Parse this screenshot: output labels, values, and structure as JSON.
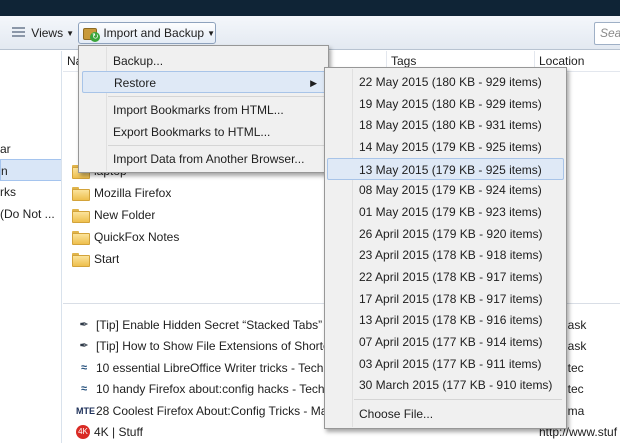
{
  "toolbar": {
    "views_label": "Views",
    "import_backup_label": "Import and Backup",
    "search_placeholder": "Sea"
  },
  "sidebar": {
    "items": [
      {
        "label": "ar"
      },
      {
        "label": "n"
      },
      {
        "label": "rks"
      },
      {
        "label": "(Do Not ..."
      }
    ]
  },
  "columns": {
    "name": "Na",
    "tags": "Tags",
    "location": "Location"
  },
  "folders": [
    {
      "label": "laptop"
    },
    {
      "label": "Mozilla Firefox"
    },
    {
      "label": "New Folder"
    },
    {
      "label": "QuickFox Notes"
    },
    {
      "label": "Start"
    }
  ],
  "bookmarks": [
    {
      "icon": "feather",
      "label": "[Tip] Enable Hidden Secret “Stacked Tabs” F",
      "url": "www.ask"
    },
    {
      "icon": "feather",
      "label": "[Tip] How to Show File Extensions of Shortc",
      "url": "www.ask"
    },
    {
      "icon": "wave",
      "label": "10 essential LibreOffice Writer tricks - TechR",
      "url": "www.tec"
    },
    {
      "icon": "wave",
      "label": "10 handy Firefox about:config hacks - TechR",
      "url": "www.tec"
    },
    {
      "icon": "mte",
      "icon_text": "MTE",
      "label": "28 Coolest Firefox About:Config Tricks - Ma",
      "url": "www.ma"
    },
    {
      "icon": "4k",
      "icon_text": "4K",
      "label": "4K | Stuff",
      "url": "http://www.stuf"
    }
  ],
  "import_menu": {
    "items": [
      {
        "label": "Backup..."
      },
      {
        "label": "Restore"
      },
      {
        "label": "Import Bookmarks from HTML..."
      },
      {
        "label": "Export Bookmarks to HTML..."
      },
      {
        "label": "Import Data from Another Browser..."
      }
    ]
  },
  "restore_menu": {
    "items": [
      {
        "label": "22 May 2015 (180 KB - 929 items)"
      },
      {
        "label": "19 May 2015 (180 KB - 929 items)"
      },
      {
        "label": "18 May 2015 (180 KB - 931 items)"
      },
      {
        "label": "14 May 2015 (179 KB - 925 items)"
      },
      {
        "label": "13 May 2015 (179 KB - 925 items)"
      },
      {
        "label": "08 May 2015 (179 KB - 924 items)"
      },
      {
        "label": "01 May 2015 (179 KB - 923 items)"
      },
      {
        "label": "26 April 2015 (179 KB - 920 items)"
      },
      {
        "label": "23 April 2015 (178 KB - 918 items)"
      },
      {
        "label": "22 April 2015 (178 KB - 917 items)"
      },
      {
        "label": "17 April 2015 (178 KB - 917 items)"
      },
      {
        "label": "13 April 2015 (178 KB - 916 items)"
      },
      {
        "label": "07 April 2015 (177 KB - 914 items)"
      },
      {
        "label": "03 April 2015 (177 KB - 911 items)"
      },
      {
        "label": "30 March 2015 (177 KB - 910 items)"
      }
    ],
    "choose_file": "Choose File...",
    "highlighted_index": 4
  },
  "colors": {
    "toolbar_bg": "#e3e9f1",
    "menu_bg": "#f0f0f0",
    "highlight_bg": "#dfe9f6",
    "highlight_border": "#a8c4e8",
    "folder": "#eebf4d",
    "titlebar": "#0f2436"
  }
}
